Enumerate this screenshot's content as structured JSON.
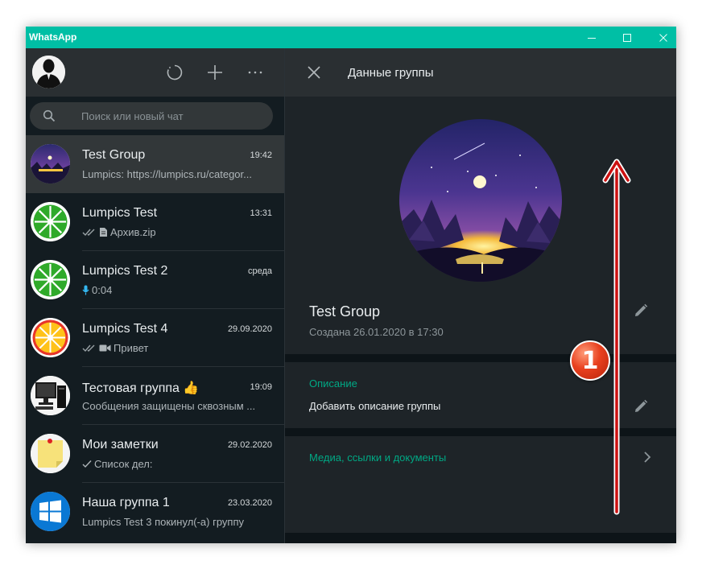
{
  "window": {
    "title": "WhatsApp",
    "accent_color": "#00bfa5",
    "controls": [
      "minimize-icon",
      "maximize-icon",
      "close-icon"
    ]
  },
  "left_header": {
    "icons": [
      "avatar",
      "status-icon",
      "new-chat-icon",
      "menu-icon"
    ]
  },
  "search": {
    "placeholder": "Поиск или новый чат",
    "value": ""
  },
  "chats": [
    {
      "name": "Test Group",
      "time": "19:42",
      "preview": "Lumpics: https://lumpics.ru/categor...",
      "active": true,
      "avatar": "night-landscape"
    },
    {
      "name": "Lumpics Test",
      "time": "13:31",
      "preview": "Архив.zip",
      "ticks": "double-check-icon",
      "media_icon": "document-icon",
      "avatar": "green-lime"
    },
    {
      "name": "Lumpics Test 2",
      "time": "среда",
      "preview": "0:04",
      "media_icon": "microphone-icon",
      "avatar": "green-lime"
    },
    {
      "name": "Lumpics Test 4",
      "time": "29.09.2020",
      "preview": "Привет",
      "ticks": "double-check-icon",
      "media_icon": "video-icon",
      "avatar": "orange-lemon"
    },
    {
      "name": "Тестовая группа 👍",
      "time": "19:09",
      "preview": "Сообщения защищены сквозным ...",
      "avatar": "computer"
    },
    {
      "name": "Мои заметки",
      "time": "29.02.2020",
      "preview": "Список дел:",
      "ticks": "single-check-icon",
      "avatar": "sticky-note"
    },
    {
      "name": "Наша группа 1",
      "time": "23.03.2020",
      "preview": "Lumpics Test 3 покинул(-а) группу",
      "avatar": "windows-logo"
    }
  ],
  "right_header": {
    "title": "Данные группы"
  },
  "group_info": {
    "name": "Test Group",
    "created": "Создана 26.01.2020 в 17:30",
    "description_label": "Описание",
    "description_add": "Добавить описание группы",
    "media_label": "Медиа, ссылки и документы"
  },
  "annotation": {
    "badge_number": "1",
    "arrow_color": "#cc1010",
    "arrow_direction": "up"
  }
}
